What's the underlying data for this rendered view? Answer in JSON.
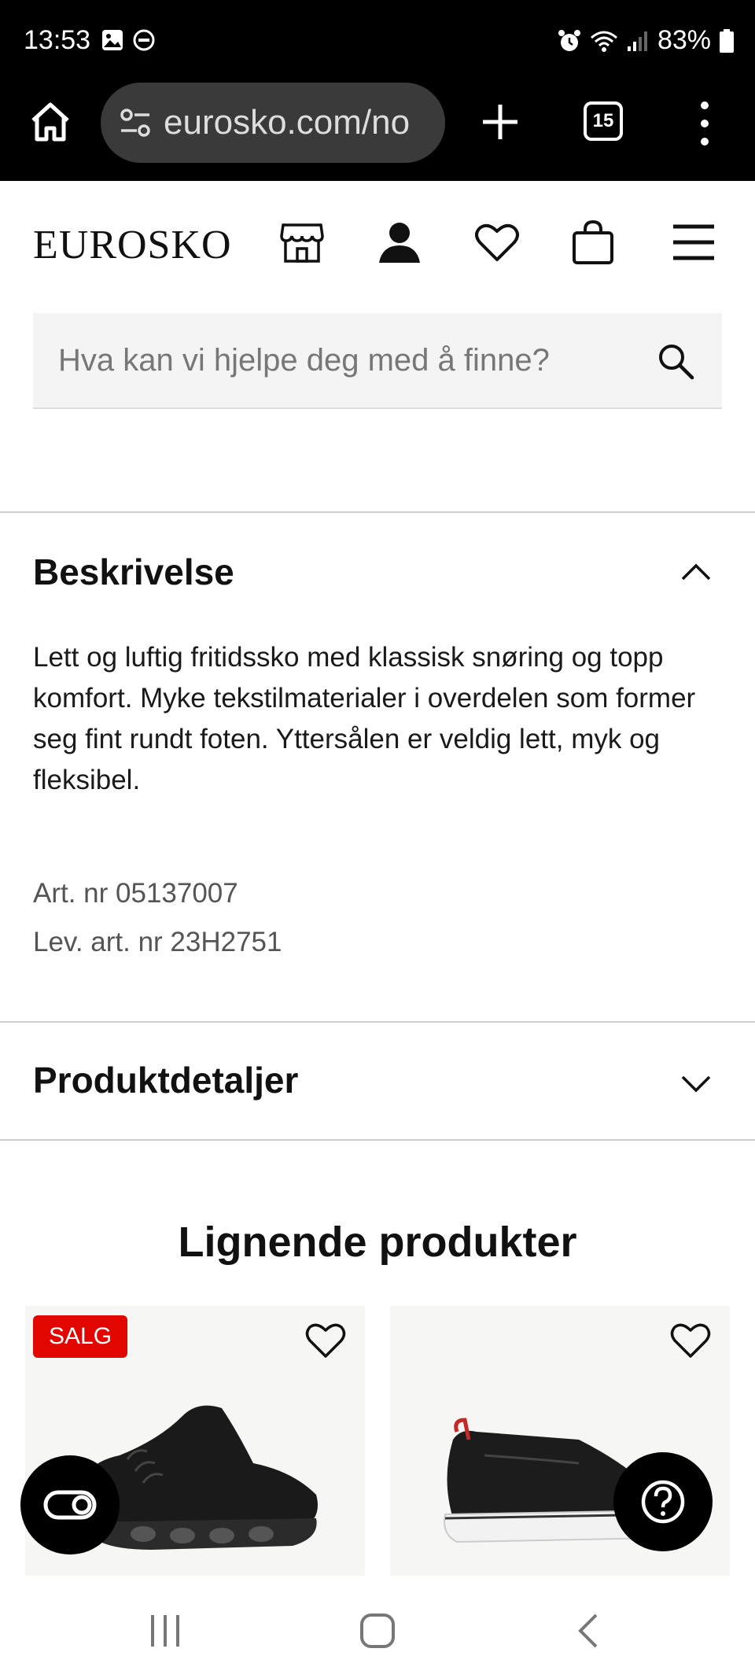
{
  "status_bar": {
    "time": "13:53",
    "battery": "83%"
  },
  "browser": {
    "url": "eurosko.com/no",
    "tab_count": "15"
  },
  "header": {
    "logo": "EUROSKO"
  },
  "search": {
    "placeholder": "Hva kan vi hjelpe deg med å finne?"
  },
  "description_section": {
    "title": "Beskrivelse",
    "text": "Lett og luftig fritidssko med klassisk snøring og topp komfort. Myke tekstilmaterialer i overdelen som former seg fint rundt foten. Yttersålen er veldig lett, myk og fleksibel.",
    "art_nr": "Art. nr 05137007",
    "lev_art_nr": "Lev. art. nr 23H2751"
  },
  "details_section": {
    "title": "Produktdetaljer"
  },
  "similar": {
    "title": "Lignende produkter",
    "products": [
      {
        "badge": "SALG"
      },
      {
        "badge": ""
      }
    ]
  },
  "colors": {
    "sale_red": "#e10600",
    "card_bg": "#f6f6f5",
    "search_bg": "#f4f4f4"
  }
}
